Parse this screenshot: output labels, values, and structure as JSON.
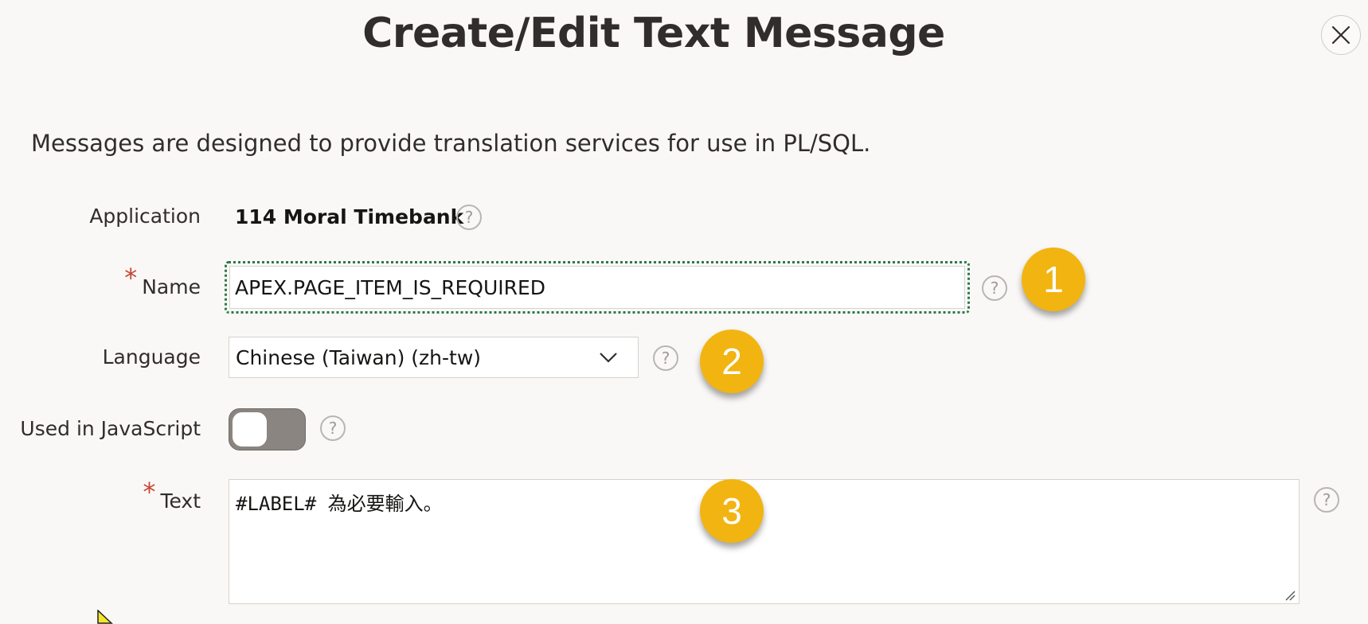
{
  "dialog": {
    "title": "Create/Edit Text Message",
    "close_icon": "close-icon",
    "intro": "Messages are designed to provide translation services for use in PL/SQL."
  },
  "form": {
    "application": {
      "label": "Application",
      "value": "114 Moral Timebank"
    },
    "name": {
      "label": "Name",
      "required_marker": "*",
      "value": "APEX.PAGE_ITEM_IS_REQUIRED"
    },
    "language": {
      "label": "Language",
      "selected": "Chinese (Taiwan) (zh-tw)"
    },
    "used_in_js": {
      "label": "Used in JavaScript",
      "checked": false
    },
    "text": {
      "label": "Text",
      "required_marker": "*",
      "value": "#LABEL# 為必要輸入。"
    },
    "help_glyph": "?"
  },
  "callouts": [
    "1",
    "2",
    "3"
  ],
  "colors": {
    "accent": "#f2b411",
    "required": "#c74634",
    "focus": "#2e7a4a"
  }
}
